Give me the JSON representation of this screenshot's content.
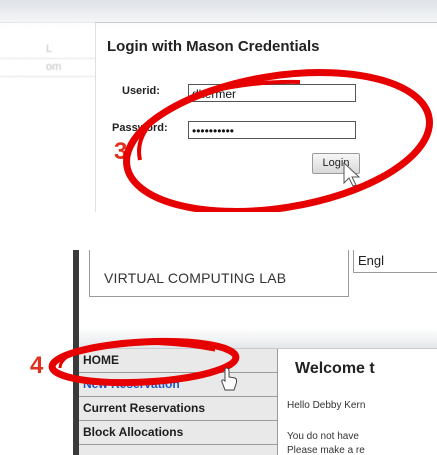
{
  "step1": {
    "number": "3",
    "title": "Login with Mason Credentials",
    "userid_label": "Userid:",
    "userid_value": "dkermer",
    "password_label": "Password:",
    "password_value": "••••••••••",
    "login_button": "Login",
    "left_menu": [
      "L",
      "om"
    ]
  },
  "step2": {
    "number": "4",
    "header_title": "VIRTUAL COMPUTING LAB",
    "language": "Engl",
    "nav_items": [
      "HOME",
      "New Reservation",
      "Current Reservations",
      "Block Allocations"
    ],
    "welcome_title": "Welcome t",
    "greeting": "Hello Debby Kern",
    "notice_line1": "You do not have",
    "notice_line2": "Please make a re"
  },
  "colors": {
    "annotation": "#e60000",
    "step_number": "#e03020",
    "link": "#1a55c9"
  },
  "icons": {
    "cursor": "mouse-pointer-icon",
    "hand": "hand-pointer-icon"
  }
}
